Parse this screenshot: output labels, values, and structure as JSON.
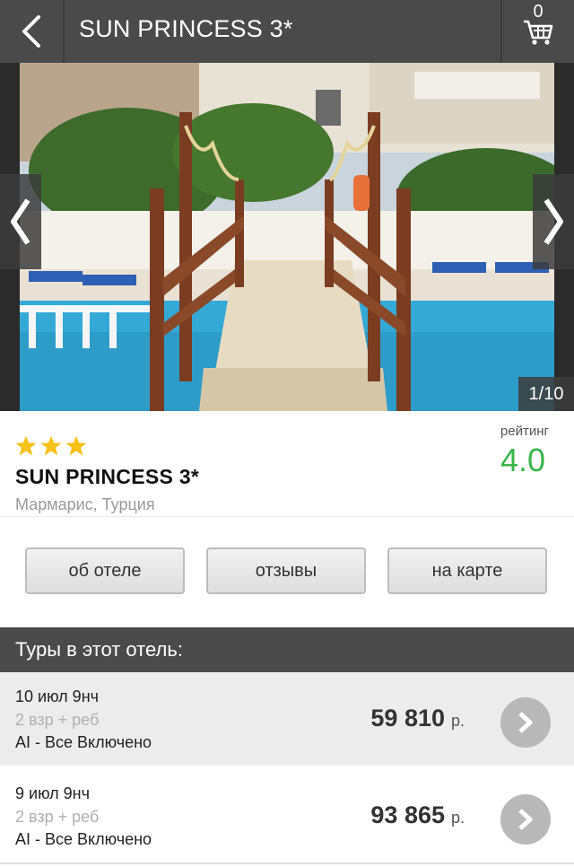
{
  "header": {
    "title": "SUN PRINCESS 3*",
    "back_icon": "chevron-left-icon",
    "cart_icon": "cart-icon",
    "cart_count": "0"
  },
  "gallery": {
    "counter": "1/10",
    "current_index": 1,
    "total": 10,
    "prev_icon": "chevron-left-icon",
    "next_icon": "chevron-right-icon"
  },
  "hotel": {
    "stars": 3,
    "name": "SUN PRINCESS 3*",
    "location": "Мармарис, Турция",
    "rating_label": "рейтинг",
    "rating_value": "4.0"
  },
  "tabs": {
    "about": "об отеле",
    "reviews": "отзывы",
    "map": "на карте"
  },
  "tours": {
    "header": "Туры в этот отель:",
    "items": [
      {
        "date": "10 июл 9нч",
        "people": "2 взр + реб",
        "meal": "AI - Все Включено",
        "price": "59 810",
        "currency": "р."
      },
      {
        "date": "9 июл 9нч",
        "people": "2 взр + реб",
        "meal": "AI - Все Включено",
        "price": "93 865",
        "currency": "р."
      }
    ]
  },
  "colors": {
    "header_bg": "#4a4a4a",
    "rating_green": "#39b54a",
    "star_yellow": "#f6c21a",
    "go_button": "#b8b8b8"
  }
}
